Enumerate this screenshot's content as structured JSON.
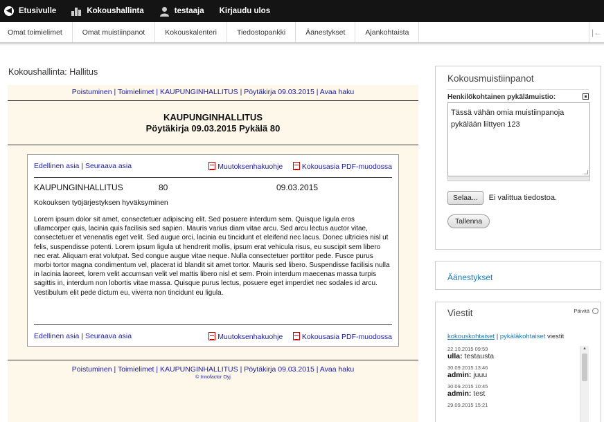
{
  "topbar": {
    "home_label": "Etusivulle",
    "meetings_label": "Kokoushallinta",
    "user_label": "testaaja",
    "logout_label": "Kirjaudu ulos"
  },
  "nav": {
    "items": [
      "Omat toimielimet",
      "Omat muistiinpanot",
      "Kokouskalenteri",
      "Tiedostopankki",
      "Äänestykset",
      "Ajankohtaista"
    ]
  },
  "page_heading": "Kokoushallinta: Hallitus",
  "breadcrumb": {
    "links": [
      "Poistuminen",
      "Toimielimet",
      "KAUPUNGINHALLITUS",
      "Pöytäkirja 09.03.2015",
      "Avaa haku"
    ],
    "separator": "|"
  },
  "doc": {
    "title_line1": "KAUPUNGINHALLITUS",
    "title_line2": "Pöytäkirja 09.03.2015 Pykälä 80",
    "prev_label": "Edellinen asia",
    "next_label": "Seuraava asia",
    "nav_separator": "|",
    "appeal_label": "Muutoksenhakuohje",
    "pdf_label": "Kokousasia PDF-muodossa",
    "body_name": "KAUPUNGINHALLITUS",
    "section_number": "80",
    "date": "09.03.2015",
    "subject": "Kokouksen työjärjestyksen hyväksyminen",
    "body": "Lorem ipsum dolor sit amet, consectetuer adipiscing elit. Sed posuere interdum sem. Quisque ligula eros ullamcorper quis, lacinia quis facilisis sed sapien. Mauris varius diam vitae arcu. Sed arcu lectus auctor vitae, consectetuer et venenatis eget velit. Sed augue orci, lacinia eu tincidunt et eleifend nec lacus. Donec ultricies nisl ut felis, suspendisse potenti. Lorem ipsum ligula ut hendrerit mollis, ipsum erat vehicula risus, eu suscipit sem libero nec erat. Aliquam erat volutpat. Sed congue augue vitae neque. Nulla consectetuer porttitor pede. Fusce purus morbi tortor magna condimentum vel, placerat id blandit sit amet tortor. Mauris sed libero. Suspendisse facilisis nulla in lacinia laoreet, lorem velit accumsan velit vel mattis libero nisl et sem. Proin interdum maecenas massa turpis sagittis in, interdum non lobortis vitae massa. Quisque purus lectus, posuere eget imperdiet nec sodales id arcu. Vestibulum elit pede dictum eu, viverra non tincidunt eu ligula."
  },
  "copyright": "© Innofactor Oyj",
  "notes_box": {
    "title": "Kokousmuistiinpanot",
    "label": "Henkilökohtainen pykälämuistio:",
    "text": "Tässä vähän omia muistiinpanoja pykälään liittyen 123",
    "browse_label": "Selaa...",
    "no_file_label": "Ei valittua tiedostoa.",
    "save_label": "Tallenna"
  },
  "votes_link": "Äänestykset",
  "messages": {
    "title": "Viestit",
    "refresh_label": "Päivitä",
    "filter_a": "kokouskohtaiset",
    "filter_sep": "|",
    "filter_b": "pykäläkohtaiset",
    "filter_suffix": "viestit",
    "items": [
      {
        "time": "22.10.2015 09:59",
        "author": "ulla:",
        "text": "testausta"
      },
      {
        "time": "30.09.2015 13:46",
        "author": "admin:",
        "text": "juuu"
      },
      {
        "time": "30.09.2015 10:45",
        "author": "admin:",
        "text": "test"
      },
      {
        "time": "29.09.2015 15:21",
        "author": "",
        "text": ""
      }
    ]
  },
  "colors": {
    "link": "#1a1aa6",
    "topbar": "#141414",
    "panel_bg": "#fdf8ea",
    "side_link": "#1a7ab8"
  }
}
